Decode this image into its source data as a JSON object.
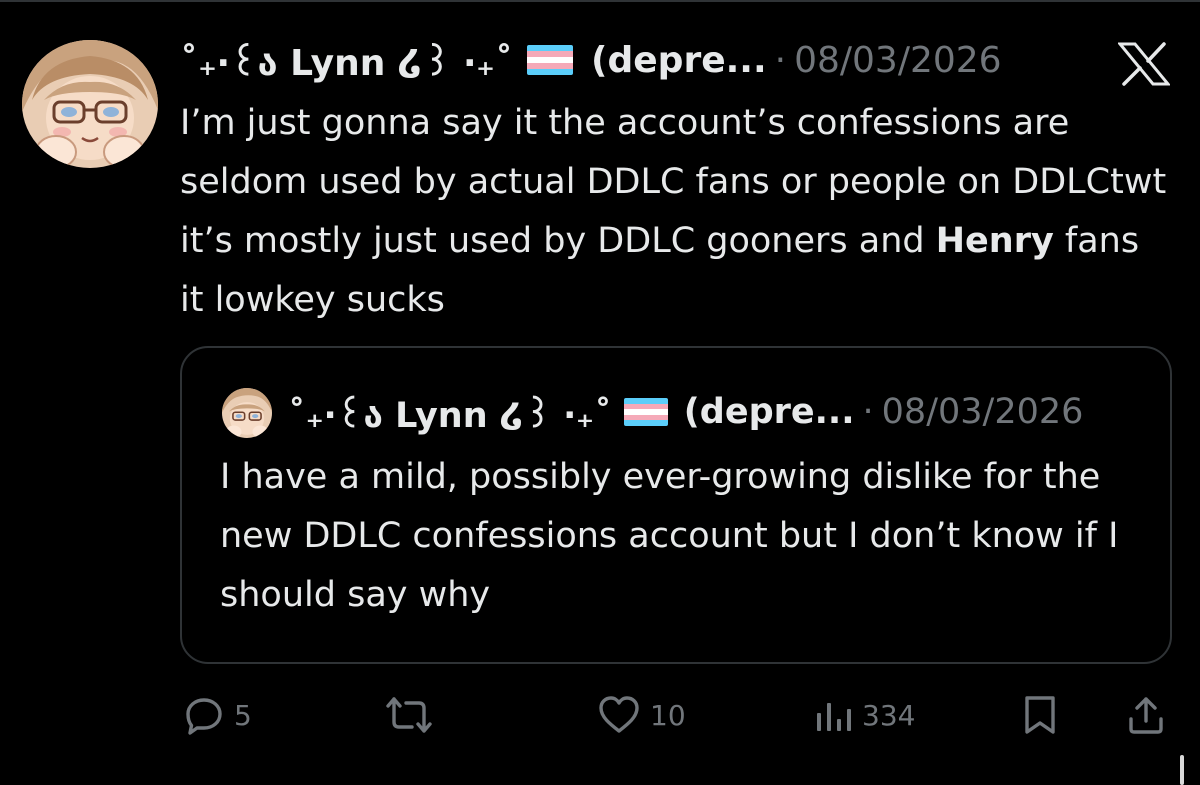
{
  "colors": {
    "background": "#000000",
    "text_primary": "#e7e9ea",
    "text_secondary": "#71767b",
    "border": "#2f3336",
    "flag_blue": "#5bcefa",
    "flag_pink": "#f5a9b8",
    "flag_white": "#ffffff"
  },
  "post": {
    "author": {
      "display_name": "˚₊‧꒰ა Lynn ໒꒱ ‧₊˚",
      "flag_icon": "trans-flag-icon",
      "handle_truncated": "(depre...",
      "avatar_icon": "anime-avatar-icon"
    },
    "separator": "·",
    "date": "08/03/2026",
    "platform_icon": "x-logo-icon",
    "text_before_bold": "I’m just gonna say it the account’s confessions are seldom used by actual DDLC fans or people on DDLCtwt it’s mostly just used by DDLC gooners and ",
    "text_bold": "Henry",
    "text_after_bold": " fans it lowkey sucks"
  },
  "quoted_post": {
    "author": {
      "display_name": "˚₊‧꒰ა Lynn ໒꒱ ‧₊˚",
      "flag_icon": "trans-flag-icon",
      "handle_truncated": "(depre..."
    },
    "separator": "·",
    "date": "08/03/2026",
    "text": "I have a mild, possibly ever-growing dislike for the new DDLC confessions account but I don’t know if I should say why"
  },
  "actions": {
    "reply": {
      "icon": "reply-icon",
      "count": "5"
    },
    "repost": {
      "icon": "repost-icon",
      "count": ""
    },
    "like": {
      "icon": "heart-icon",
      "count": "10"
    },
    "views": {
      "icon": "views-icon",
      "count": "334"
    },
    "bookmark": {
      "icon": "bookmark-icon"
    },
    "share": {
      "icon": "share-icon"
    }
  }
}
